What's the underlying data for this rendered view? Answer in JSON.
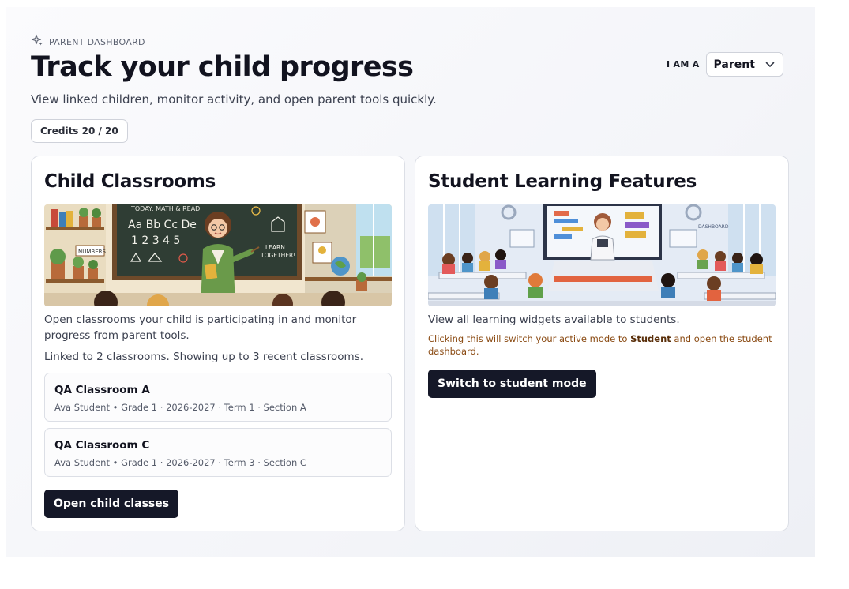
{
  "header": {
    "eyebrow": "PARENT DASHBOARD",
    "title": "Track your child progress",
    "subtitle": "View linked children, monitor activity, and open parent tools quickly.",
    "credits": "Credits 20 / 20"
  },
  "role": {
    "label": "I AM A",
    "selected": "Parent"
  },
  "child_card": {
    "title": "Child Classrooms",
    "description": "Open classrooms your child is participating in and monitor progress from parent tools.",
    "linked_note": "Linked to 2 classrooms. Showing up to 3 recent classrooms.",
    "classrooms": [
      {
        "name": "QA Classroom A",
        "meta": "Ava Student • Grade 1 · 2026-2027 · Term 1 · Section A"
      },
      {
        "name": "QA Classroom C",
        "meta": "Ava Student • Grade 1 · 2026-2027 · Term 3 · Section C"
      }
    ],
    "button": "Open child classes",
    "image": {
      "board_top": "TODAY: MATH & READ",
      "board_row1": "Aa Bb Cc De",
      "board_row2": "1 2 3 4 5",
      "sign1": "LEARN",
      "sign2": "TOGETHER!",
      "numbers_label": "NUMBERS"
    }
  },
  "student_card": {
    "title": "Student Learning Features",
    "description": "View all learning widgets available to students.",
    "warn_prefix": "Clicking this will switch your active mode to ",
    "warn_bold": "Student",
    "warn_suffix": " and open the student dashboard.",
    "button": "Switch to student mode",
    "image": {
      "dashboard_label": "DASHBOARD"
    }
  },
  "colors": {
    "primary_button": "#151828",
    "warning_text": "#8a4a12",
    "chalkboard": "#2f3d34"
  }
}
